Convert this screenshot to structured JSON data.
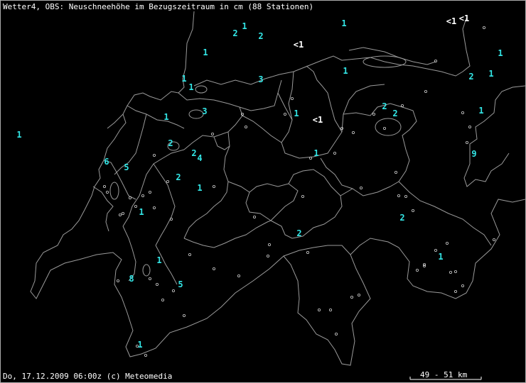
{
  "header": {
    "title": "Wetter4, OBS: Neuschneehöhe im Bezugszeitraum in cm (88 Stationen)"
  },
  "footer": {
    "datetime": "Do, 17.12.2009 06:00z (c) Meteomedia",
    "scale": "49 - 51 km"
  },
  "colors": {
    "value": "#33e6e6",
    "lt_value": "#ffffff",
    "border": "#9a9a9a",
    "background": "#000000"
  },
  "values": [
    {
      "text": "2"
    },
    {
      "text": "1"
    },
    {
      "text": "2"
    },
    {
      "text": "1"
    },
    {
      "text": "<1"
    },
    {
      "text": "<1"
    },
    {
      "text": "1"
    },
    {
      "text": "1"
    },
    {
      "text": "1"
    },
    {
      "text": "1"
    },
    {
      "text": "3"
    },
    {
      "text": "1"
    },
    {
      "text": "1"
    },
    {
      "text": "2"
    },
    {
      "text": "1"
    },
    {
      "text": "3"
    },
    {
      "text": "1"
    },
    {
      "text": "1"
    },
    {
      "text": "<1"
    },
    {
      "text": "2"
    },
    {
      "text": "2"
    },
    {
      "text": "1"
    },
    {
      "text": "2"
    },
    {
      "text": "4"
    },
    {
      "text": "2"
    },
    {
      "text": "6"
    },
    {
      "text": "5"
    },
    {
      "text": "9"
    },
    {
      "text": "2"
    },
    {
      "text": "1"
    },
    {
      "text": "1"
    },
    {
      "text": "2"
    },
    {
      "text": "1"
    },
    {
      "text": "1"
    },
    {
      "text": "8"
    },
    {
      "text": "5"
    },
    {
      "text": "1"
    },
    {
      "text": "2"
    },
    {
      "text": "1"
    },
    {
      "text": "<1"
    }
  ]
}
